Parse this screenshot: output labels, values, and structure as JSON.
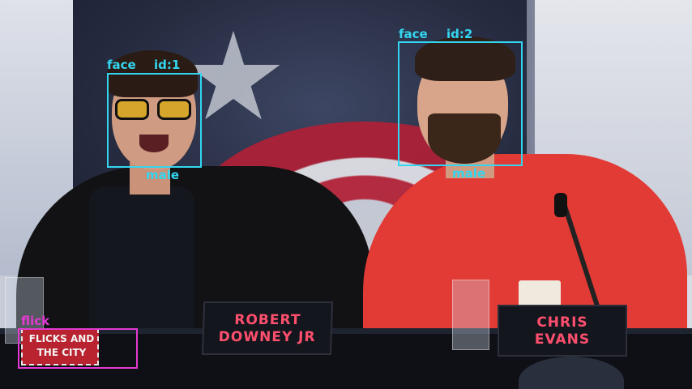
{
  "colors": {
    "detection_box": "#33d6f0",
    "logo_box": "#e23ad1",
    "plate_text": "#ff4f6e"
  },
  "detections": [
    {
      "class_label": "face",
      "id_label": "id:1",
      "gender_label": "male"
    },
    {
      "class_label": "face",
      "id_label": "id:2",
      "gender_label": "male"
    }
  ],
  "logo": {
    "label": "flick",
    "text_line1": "FLICKS AND",
    "text_line2": "THE CITY"
  },
  "name_plates": [
    {
      "line1": "ROBERT",
      "line2": "DOWNEY JR"
    },
    {
      "line1": "CHRIS",
      "line2": "EVANS"
    }
  ]
}
